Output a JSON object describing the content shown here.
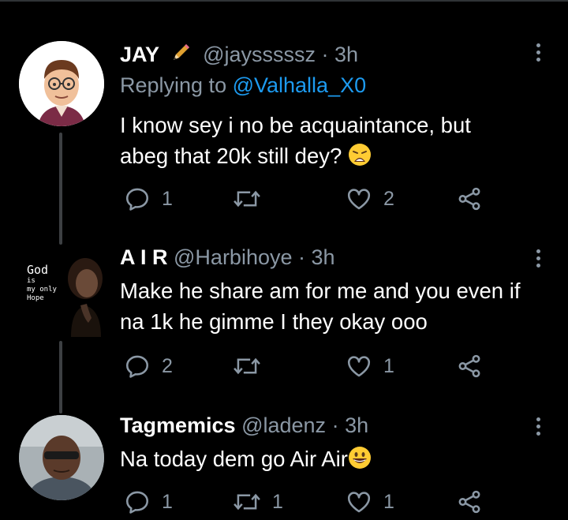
{
  "tweets": [
    {
      "name": "JAY",
      "handle": "@jaysssssz",
      "sep": " · ",
      "time": "3h",
      "replying_prefix": "Replying to ",
      "replying_to": "@Valhalla_X0",
      "text_line1": "I know sey i no be acquaintance, but",
      "text_line2": "abeg that 20k still dey?",
      "emoji": "weary-face-icon",
      "replies": "1",
      "retweets": "",
      "likes": "2"
    },
    {
      "name": "A I R",
      "handle": "@Harbihoye",
      "sep": " · ",
      "time": "3h",
      "text_line1": "Make he share am for me and you even if",
      "text_line2": "na 1k he gimme I they okay ooo",
      "avatar_text": [
        "God",
        "is",
        "my only",
        "Hope"
      ],
      "replies": "2",
      "retweets": "",
      "likes": "1"
    },
    {
      "name": "Tagmemics",
      "handle": "@ladenz",
      "sep": " · ",
      "time": "3h",
      "text_line1": "Na today dem go Air Air",
      "emoji": "grinning-face-icon",
      "replies": "1",
      "retweets": "1",
      "likes": "1"
    }
  ],
  "colors": {
    "background": "#000000",
    "muted": "#8b98a5",
    "link": "#1d9bf0",
    "thread_line": "#3d4043"
  }
}
